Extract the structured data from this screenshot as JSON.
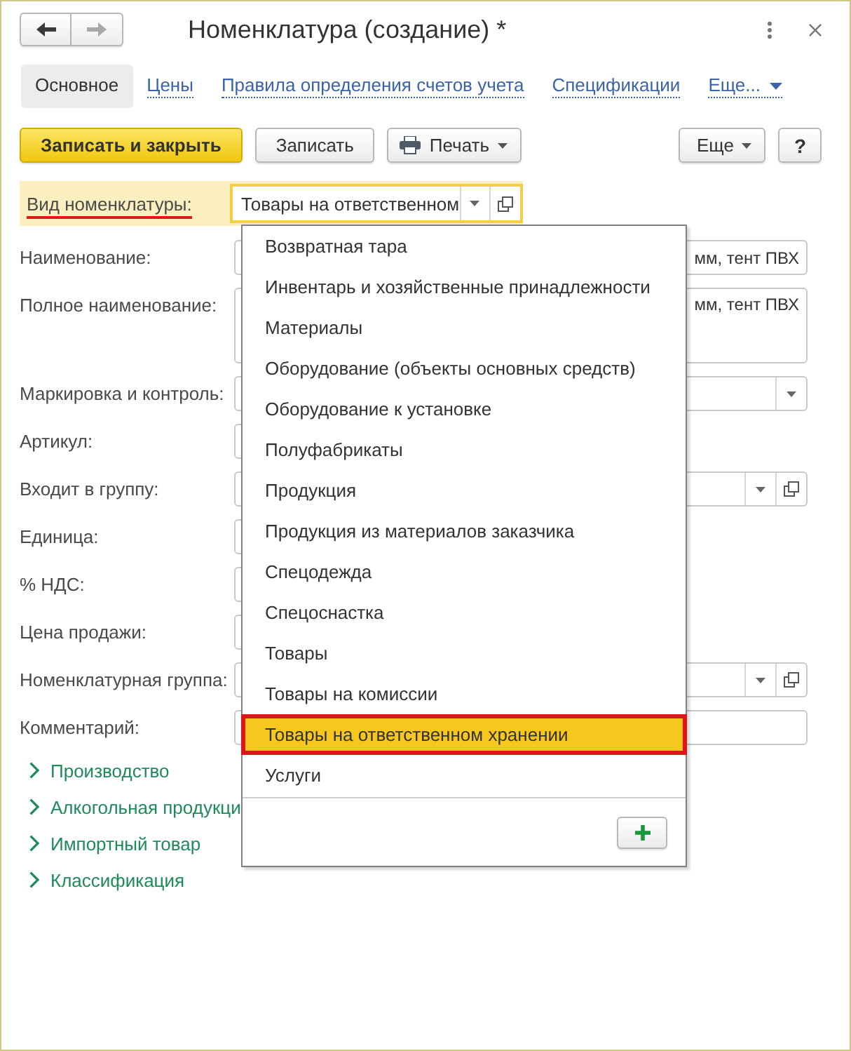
{
  "window": {
    "title": "Номенклатура (создание) *"
  },
  "nav": [
    {
      "kind": "back",
      "disabled": false
    },
    {
      "kind": "forward",
      "disabled": true
    }
  ],
  "tabs": [
    {
      "label": "Основное",
      "kind": "tab",
      "selected": true
    },
    {
      "label": "Цены",
      "kind": "tab",
      "selected": false
    },
    {
      "label": "Правила определения счетов учета",
      "kind": "tab",
      "selected": false
    },
    {
      "label": "Спецификации",
      "kind": "tab",
      "selected": false
    },
    {
      "label": "Еще...",
      "kind": "menu",
      "selected": false
    }
  ],
  "toolbar": {
    "buttons": [
      {
        "label": "Записать и закрыть",
        "kind": "primary"
      },
      {
        "label": "Записать",
        "kind": "plain"
      },
      {
        "label": "Печать",
        "kind": "print"
      }
    ],
    "right_buttons": [
      {
        "label": "Еще",
        "kind": "menu"
      },
      {
        "label": "?",
        "kind": "help"
      }
    ]
  },
  "form": {
    "kind_field": {
      "label": "Вид номенклатуры:",
      "value": "Товары на ответственном",
      "focused": true,
      "marked": true
    },
    "fields": [
      {
        "label": "Наименование:",
        "kind": "text",
        "value": "мм, тент ПВХ"
      },
      {
        "label": "Полное наименование:",
        "kind": "textarea",
        "value": "мм, тент ПВХ"
      },
      {
        "label": "Маркировка и контроль:",
        "kind": "select"
      },
      {
        "label": "Артикул:",
        "kind": "short"
      },
      {
        "label": "Входит в группу:",
        "kind": "select-open"
      },
      {
        "label": "Единица:",
        "kind": "short"
      },
      {
        "label": "% НДС:",
        "kind": "short"
      },
      {
        "label": "Цена продажи:",
        "kind": "short"
      },
      {
        "label": "Номенклатурная группа:",
        "kind": "select-open"
      },
      {
        "label": "Комментарий:",
        "kind": "text"
      }
    ],
    "groups": [
      {
        "label": "Производство",
        "expanded": false
      },
      {
        "label": "Алкогольная продукци",
        "expanded": false
      },
      {
        "label": "Импортный товар",
        "expanded": false
      },
      {
        "label": "Классификация",
        "expanded": false
      }
    ]
  },
  "dropdown": {
    "items": [
      {
        "label": "Возвратная тара",
        "selected": false
      },
      {
        "label": "Инвентарь и хозяйственные принадлежности",
        "selected": false
      },
      {
        "label": "Материалы",
        "selected": false
      },
      {
        "label": "Оборудование (объекты основных средств)",
        "selected": false
      },
      {
        "label": "Оборудование к установке",
        "selected": false
      },
      {
        "label": "Полуфабрикаты",
        "selected": false
      },
      {
        "label": "Продукция",
        "selected": false
      },
      {
        "label": "Продукция из материалов заказчика",
        "selected": false
      },
      {
        "label": "Спецодежда",
        "selected": false
      },
      {
        "label": "Спецоснастка",
        "selected": false
      },
      {
        "label": "Товары",
        "selected": false
      },
      {
        "label": "Товары на комиссии",
        "selected": false
      },
      {
        "label": "Товары на ответственном хранении",
        "selected": true
      },
      {
        "label": "Услуги",
        "selected": false
      }
    ]
  }
}
